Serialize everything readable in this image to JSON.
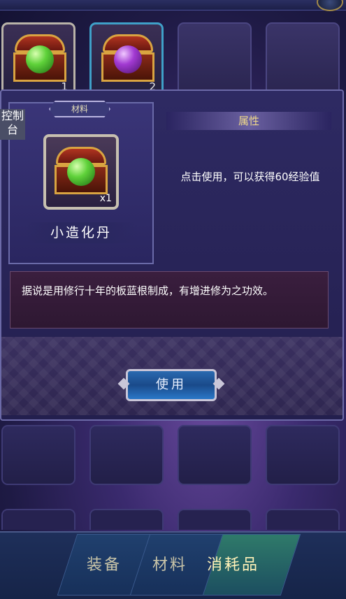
{
  "top_slots": [
    {
      "count": "1",
      "orb": "green"
    },
    {
      "count": "2",
      "orb": "purple"
    }
  ],
  "console_label": "控制台",
  "item_card": {
    "category_tab": "材料",
    "quantity": "x1",
    "name": "小造化丹"
  },
  "attributes": {
    "header": "属性",
    "effect": "点击使用，可以获得60经验值"
  },
  "description": "据说是用修行十年的板蓝根制成，有增进修为之功效。",
  "use_button": "使用",
  "bottom_tabs": [
    {
      "label": "装备",
      "active": false
    },
    {
      "label": "材料",
      "active": false
    },
    {
      "label": "消耗品",
      "active": true
    }
  ],
  "colors": {
    "accent_gold": "#f0d98a",
    "button_blue": "#2a6ab0",
    "active_tab": "#2f7a6a"
  }
}
